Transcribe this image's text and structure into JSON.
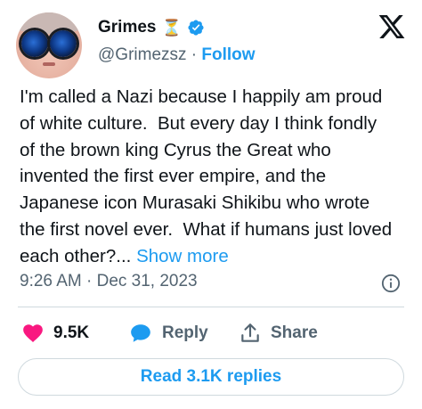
{
  "author": {
    "display_name": "Grimes",
    "name_emoji": "⏳",
    "handle": "@Grimezsz",
    "separator": "·",
    "follow_label": "Follow"
  },
  "tweet": {
    "text": "I'm called a Nazi because I happily am proud\nof white culture.  But every day I think fondly\nof the brown king Cyrus the Great who\ninvented the first ever empire, and the\nJapanese icon Murasaki Shikibu who wrote\nthe first novel ever.  What if humans just loved\neach other?... ",
    "show_more_label": "Show more",
    "timestamp": "9:26 AM · Dec 31, 2023"
  },
  "actions": {
    "like_count": "9.5K",
    "reply_label": "Reply",
    "share_label": "Share"
  },
  "read_replies_label": "Read 3.1K replies",
  "colors": {
    "accent": "#1d9bf0",
    "like": "#f91880",
    "secondary_text": "#536471",
    "primary_text": "#0f1419"
  },
  "icons": [
    "x-logo-icon",
    "verified-badge-icon",
    "info-icon",
    "heart-icon",
    "reply-bubble-icon",
    "share-icon"
  ]
}
